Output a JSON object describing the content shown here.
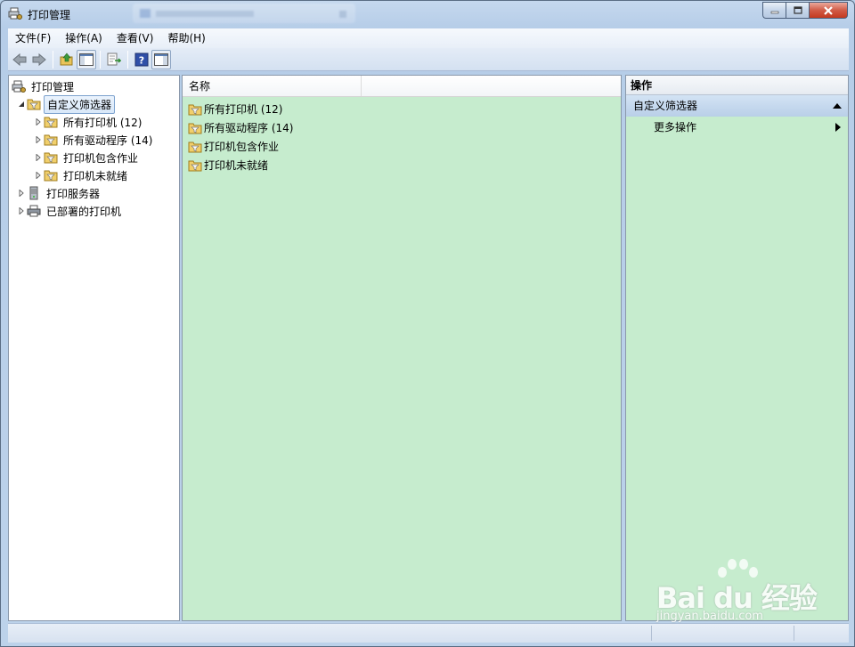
{
  "window": {
    "title": "打印管理"
  },
  "menu": {
    "items": [
      "文件(F)",
      "操作(A)",
      "查看(V)",
      "帮助(H)"
    ]
  },
  "toolbar": {
    "buttons": [
      "back-icon",
      "forward-icon",
      "up-folder-icon",
      "show-hide-tree-icon",
      "export-list-icon",
      "help-icon",
      "show-hide-action-pane-icon"
    ]
  },
  "tree": {
    "root": "打印管理",
    "custom_filters": "自定义筛选器",
    "filters": [
      "所有打印机 (12)",
      "所有驱动程序 (14)",
      "打印机包含作业",
      "打印机未就绪"
    ],
    "print_servers": "打印服务器",
    "deployed_printers": "已部署的打印机"
  },
  "list": {
    "column_name": "名称",
    "rows": [
      "所有打印机 (12)",
      "所有驱动程序 (14)",
      "打印机包含作业",
      "打印机未就绪"
    ]
  },
  "actions": {
    "header": "操作",
    "section": "自定义筛选器",
    "more": "更多操作"
  },
  "watermark": {
    "logo_text": "Bai du 经验",
    "url": "jingyan.baidu.com"
  },
  "colors": {
    "pane_green": "#c6ecce",
    "selection_border": "#7da2ce",
    "chrome_blue": "#b9d1ea"
  }
}
